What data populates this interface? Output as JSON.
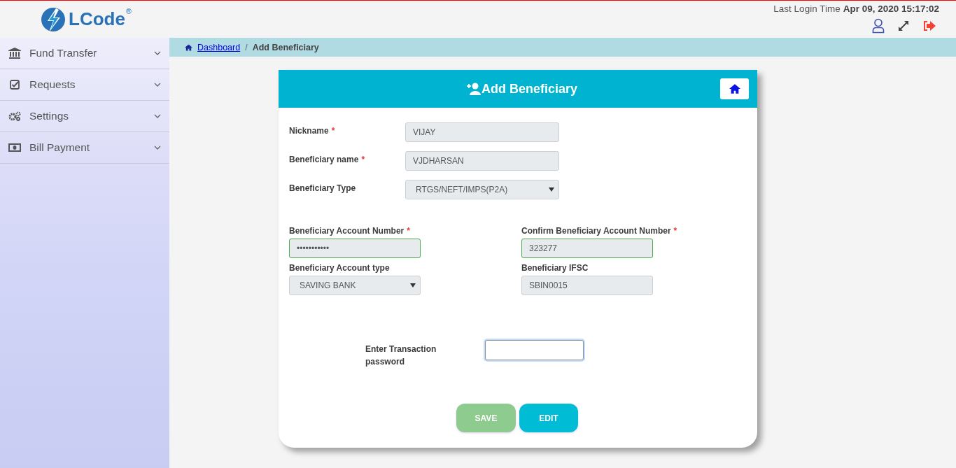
{
  "header": {
    "logo": "LCode",
    "logo_mark": "®",
    "last_login_label": "Last Login Time",
    "last_login_time": "Apr 09, 2020 15:17:02"
  },
  "sidebar": {
    "items": [
      {
        "label": "Fund Transfer",
        "expanded": false
      },
      {
        "label": "Requests",
        "expanded": false
      },
      {
        "label": "Settings",
        "expanded": false
      },
      {
        "label": "Bill Payment",
        "expanded": false
      }
    ]
  },
  "breadcrumb": {
    "separator": "/",
    "items": [
      {
        "label": "Dashboard",
        "link": true
      },
      {
        "label": "Add Beneficiary",
        "link": false
      }
    ]
  },
  "required_mark": "*",
  "card": {
    "title": "Add Beneficiary"
  },
  "top_fields": [
    {
      "label": "Nickname",
      "required": true,
      "kind": "text",
      "value": "VIJAY"
    },
    {
      "label": "Beneficiary name",
      "required": true,
      "kind": "text",
      "value": "VJDHARSAN"
    },
    {
      "label": "Beneficiary Type",
      "required": false,
      "kind": "select",
      "value": "RTGS/NEFT/IMPS(P2A)"
    }
  ],
  "account_fields": [
    {
      "label": "Beneficiary Account Number",
      "required": true,
      "kind": "text",
      "value": "•••••••••••",
      "valid": true
    },
    {
      "label": "Confirm Beneficiary Account Number",
      "required": true,
      "kind": "text",
      "value": "323277",
      "valid": true
    },
    {
      "label": "Beneficiary Account type",
      "required": false,
      "kind": "select",
      "value": "SAVING BANK",
      "valid": false
    },
    {
      "label": "Beneficiary IFSC",
      "required": false,
      "kind": "text",
      "value": "SBIN0015",
      "valid": false
    }
  ],
  "transaction": {
    "label": "Enter Transaction password",
    "focused": true
  },
  "buttons": [
    {
      "label": "SAVE",
      "color": "#8ecb8e"
    },
    {
      "label": "EDIT",
      "color": "#00bcd4"
    }
  ]
}
